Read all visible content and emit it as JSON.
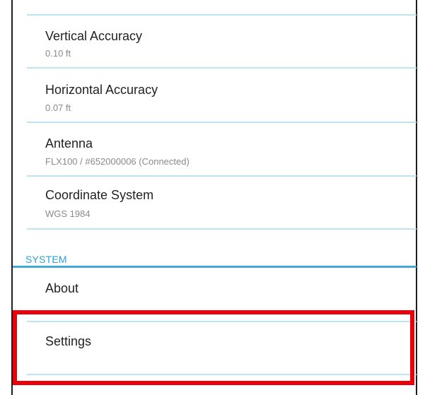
{
  "settings_list": {
    "items": [
      {
        "title": "Vertical Accuracy",
        "subtitle": "0.10 ft"
      },
      {
        "title": "Horizontal Accuracy",
        "subtitle": "0.07 ft"
      },
      {
        "title": "Antenna",
        "subtitle": "FLX100 / #652000006 (Connected)"
      },
      {
        "title": "Coordinate System",
        "subtitle": "WGS 1984"
      }
    ],
    "system_section": {
      "header": "SYSTEM",
      "items": [
        {
          "title": "About"
        },
        {
          "title": "Settings"
        }
      ]
    }
  },
  "colors": {
    "accent": "#2f9fd2",
    "divider": "#bfe3f0",
    "highlight": "#e8000b"
  }
}
